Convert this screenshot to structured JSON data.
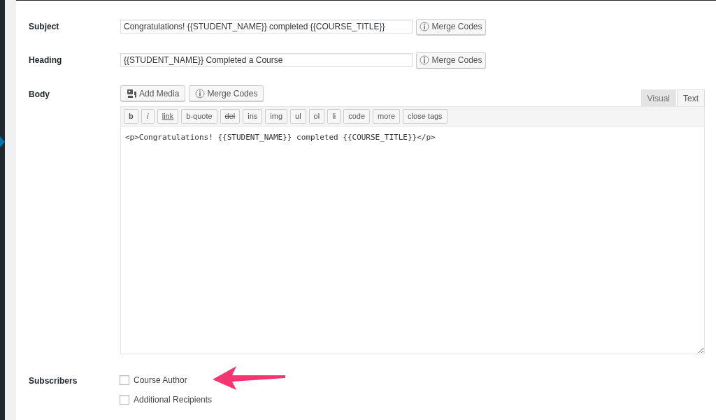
{
  "fields": [
    {
      "label": "Subject",
      "value": "Congratulations! {{STUDENT_NAME}} completed {{COURSE_TITLE}}",
      "button": "Merge Codes"
    },
    {
      "label": "Heading",
      "value": "{{STUDENT_NAME}} Completed a Course",
      "button": "Merge Codes"
    }
  ],
  "body": {
    "label": "Body",
    "media_buttons": [
      {
        "label": "Add Media",
        "kind": "media"
      },
      {
        "label": "Merge Codes",
        "kind": "merge"
      }
    ],
    "tabs": [
      {
        "label": "Visual",
        "selected": false
      },
      {
        "label": "Text",
        "selected": true
      }
    ],
    "quicktags": [
      {
        "label": "b",
        "kind": "bold"
      },
      {
        "label": "i",
        "kind": "italic"
      },
      {
        "label": "link",
        "kind": "link"
      },
      {
        "label": "b-quote",
        "kind": "plain"
      },
      {
        "label": "del",
        "kind": "strike"
      },
      {
        "label": "ins",
        "kind": "plain"
      },
      {
        "label": "img",
        "kind": "plain"
      },
      {
        "label": "ul",
        "kind": "plain"
      },
      {
        "label": "ol",
        "kind": "plain"
      },
      {
        "label": "li",
        "kind": "plain"
      },
      {
        "label": "code",
        "kind": "plain"
      },
      {
        "label": "more",
        "kind": "plain"
      },
      {
        "label": "close tags",
        "kind": "plain"
      }
    ],
    "content": "<p>Congratulations! {{STUDENT_NAME}} completed {{COURSE_TITLE}}</p>"
  },
  "subscribers": {
    "label": "Subscribers",
    "options": [
      {
        "label": "Course Author",
        "checked": false
      },
      {
        "label": "Additional Recipients",
        "checked": false
      }
    ]
  }
}
